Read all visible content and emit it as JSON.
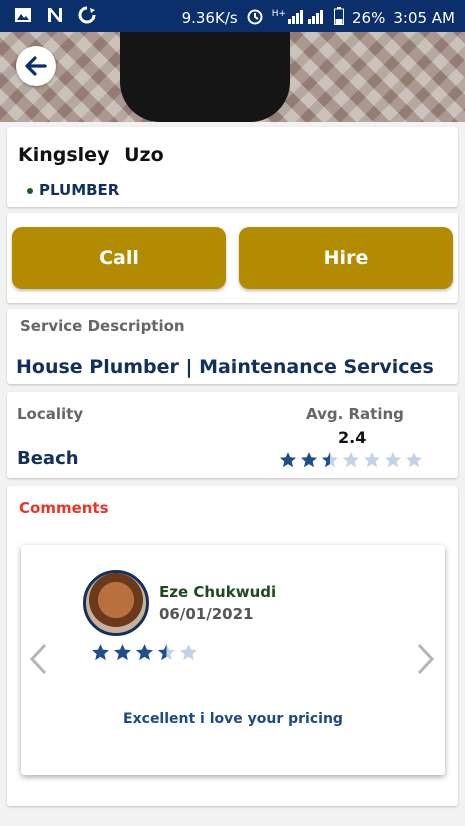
{
  "status_bar": {
    "speed": "9.36K/s",
    "network": "H+",
    "battery": "26%",
    "time": "3:05 AM",
    "icons": [
      "image-icon",
      "n-icon",
      "sync-icon",
      "alarm-icon",
      "signal-icon",
      "battery-icon"
    ]
  },
  "profile": {
    "first_name": "Kingsley",
    "last_name": "Uzo",
    "role": "PLUMBER"
  },
  "actions": {
    "call_label": "Call",
    "hire_label": "Hire",
    "button_color": "#b38b00"
  },
  "service": {
    "label": "Service Description",
    "value": "House Plumber | Maintenance Services"
  },
  "details": {
    "locality_label": "Locality",
    "locality_value": "Beach",
    "rating_label": "Avg. Rating",
    "rating_value": "2.4",
    "rating_stars": 2.5,
    "rating_max": 7
  },
  "comments": {
    "label": "Comments",
    "items": [
      {
        "name": "Eze Chukwudi",
        "date": "06/01/2021",
        "stars": 3.5,
        "max": 5,
        "text": "Excellent i love your pricing"
      }
    ]
  },
  "colors": {
    "navy": "#12305e",
    "star": "#1f4f8a",
    "star_empty": "#c3d3e6",
    "comments_red": "#e8352a",
    "name_green": "#1f4a1f"
  }
}
